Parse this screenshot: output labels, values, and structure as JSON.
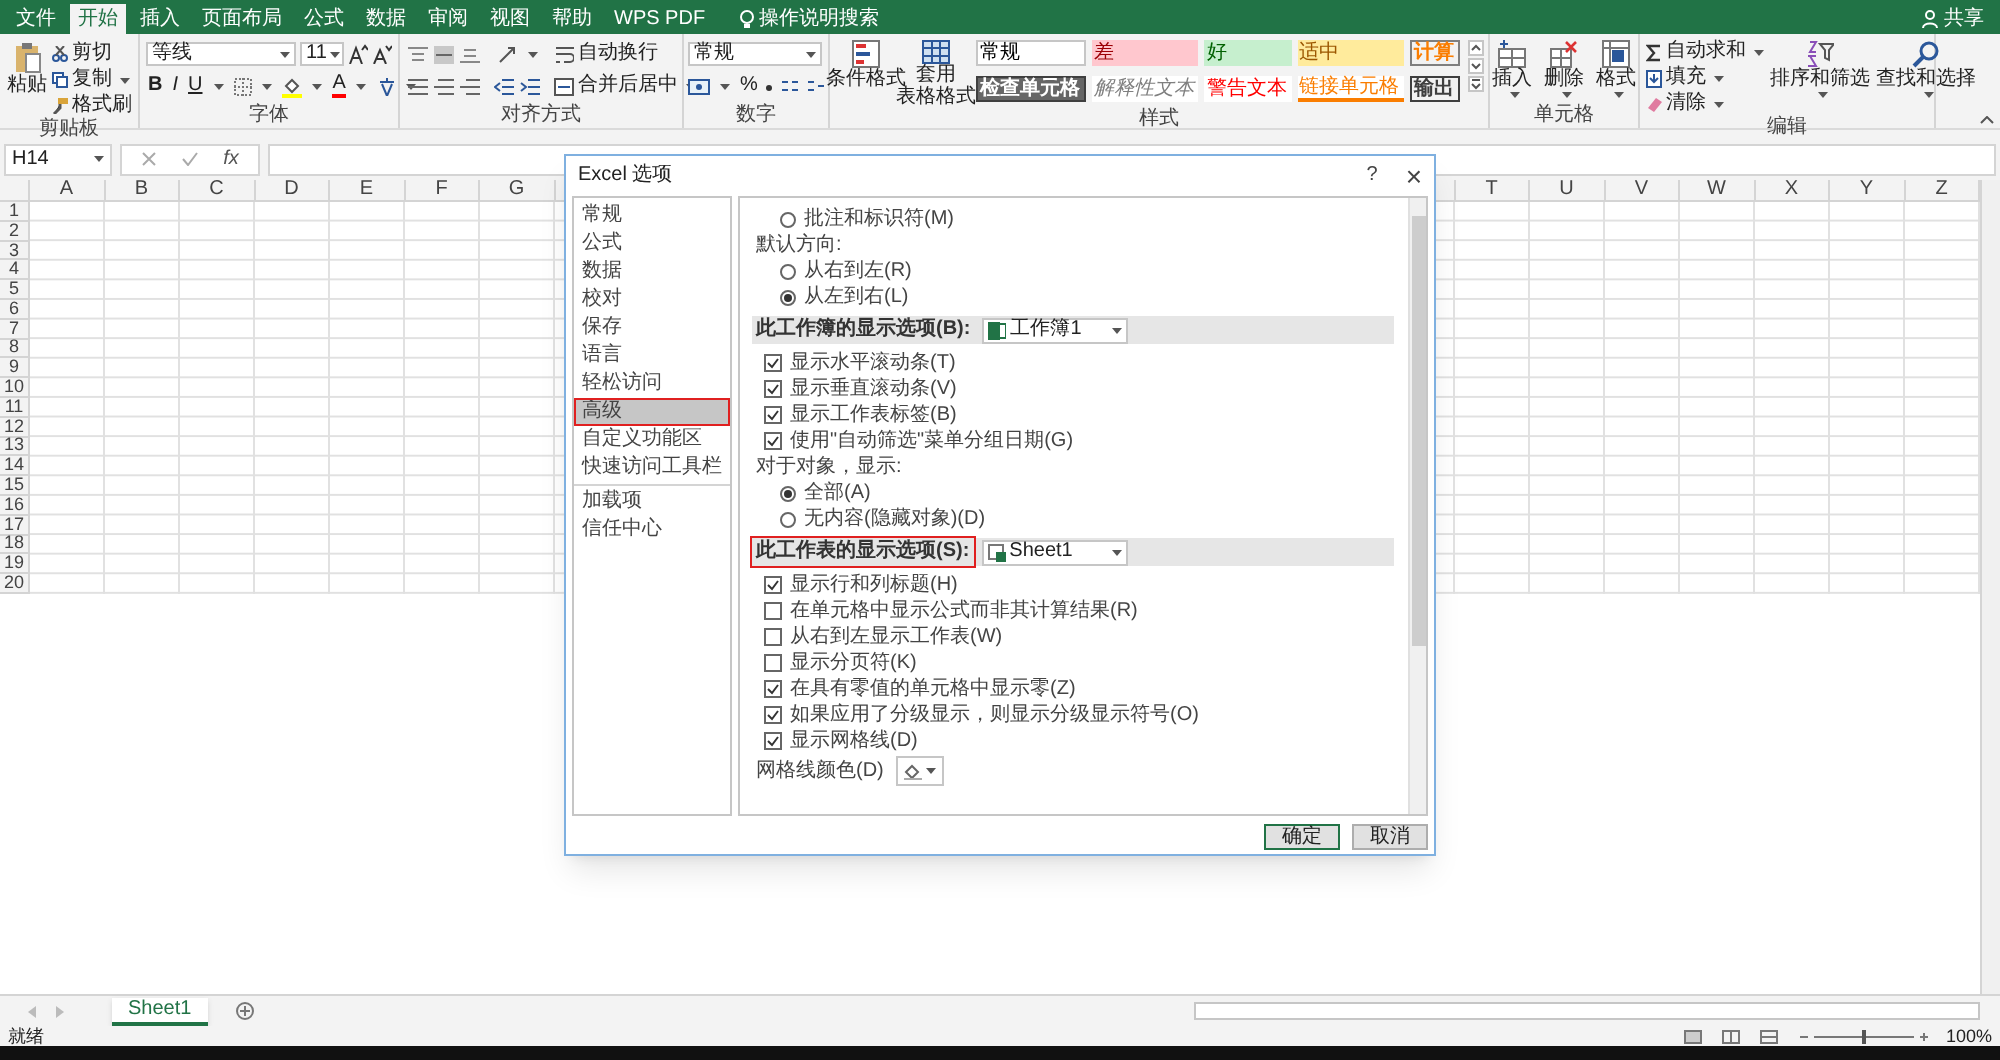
{
  "menu_tabs": [
    {
      "label": "文件",
      "selected": false
    },
    {
      "label": "开始",
      "selected": true
    },
    {
      "label": "插入",
      "selected": false
    },
    {
      "label": "页面布局",
      "selected": false
    },
    {
      "label": "公式",
      "selected": false
    },
    {
      "label": "数据",
      "selected": false
    },
    {
      "label": "审阅",
      "selected": false
    },
    {
      "label": "视图",
      "selected": false
    },
    {
      "label": "帮助",
      "selected": false
    },
    {
      "label": "WPS PDF",
      "selected": false
    }
  ],
  "tell_me": "操作说明搜索",
  "share": "共享",
  "ribbon": {
    "clipboard": {
      "label": "剪贴板",
      "paste": "粘贴",
      "cut": "剪切",
      "copy": "复制",
      "format_painter": "格式刷"
    },
    "font": {
      "label": "字体",
      "font_name": "等线",
      "font_size": "11",
      "bold": "B",
      "italic": "I",
      "underline": "U",
      "font_color": "A"
    },
    "alignment": {
      "label": "对齐方式",
      "wrap_text": "自动换行",
      "merge_center": "合并后居中"
    },
    "number": {
      "label": "数字",
      "format": "常规",
      "percent": "%"
    },
    "styles": {
      "label": "样式",
      "conditional": "条件格式",
      "table_format": [
        "套用",
        "表格格式"
      ],
      "cell_styles": [
        {
          "text": "常规",
          "kind": "normal"
        },
        {
          "text": "差",
          "kind": "bad"
        },
        {
          "text": "好",
          "kind": "good"
        },
        {
          "text": "适中",
          "kind": "neutral"
        },
        {
          "text": "计算",
          "kind": "calculation"
        },
        {
          "text": "检查单元格",
          "kind": "check"
        },
        {
          "text": "解释性文本",
          "kind": "explanatory"
        },
        {
          "text": "警告文本",
          "kind": "warning"
        },
        {
          "text": "链接单元格",
          "kind": "linked"
        },
        {
          "text": "输出",
          "kind": "output"
        }
      ]
    },
    "cells": {
      "label": "单元格",
      "insert": "插入",
      "delete": "删除",
      "format": "格式"
    },
    "editing": {
      "label": "编辑",
      "autosum": "自动求和",
      "fill": "填充",
      "clear": "清除",
      "sort_filter": "排序和筛选",
      "find_select": "查找和选择"
    }
  },
  "name_box": "H14",
  "fx": "fx",
  "columns_left": [
    "A",
    "B",
    "C",
    "D",
    "E",
    "F",
    "G"
  ],
  "columns_right": [
    "T",
    "U",
    "V",
    "W",
    "X",
    "Y",
    "Z"
  ],
  "rows": [
    "1",
    "2",
    "3",
    "4",
    "5",
    "6",
    "7",
    "8",
    "9",
    "10",
    "11",
    "12",
    "13",
    "14",
    "15",
    "16",
    "17",
    "18",
    "19",
    "20"
  ],
  "sheet_tabs": [
    {
      "label": "Sheet1",
      "selected": true
    }
  ],
  "status": "就绪",
  "zoom": "100%",
  "zoom_slider": {
    "level": 0.5
  },
  "dialog": {
    "title": "Excel 选项",
    "help": "?",
    "close": "×",
    "nav": [
      {
        "label": "常规",
        "selected": false,
        "highlighted": false
      },
      {
        "label": "公式",
        "selected": false,
        "highlighted": false
      },
      {
        "label": "数据",
        "selected": false,
        "highlighted": false
      },
      {
        "label": "校对",
        "selected": false,
        "highlighted": false
      },
      {
        "label": "保存",
        "selected": false,
        "highlighted": false
      },
      {
        "label": "语言",
        "selected": false,
        "highlighted": false
      },
      {
        "label": "轻松访问",
        "selected": false,
        "highlighted": false
      },
      {
        "label": "高级",
        "selected": true,
        "highlighted": true
      },
      {
        "label": "自定义功能区",
        "selected": false,
        "highlighted": false
      },
      {
        "label": "快速访问工具栏",
        "selected": false,
        "highlighted": false
      },
      {
        "label": "加载项",
        "selected": false,
        "highlighted": false
      },
      {
        "label": "信任中心",
        "selected": false,
        "highlighted": false
      }
    ],
    "options": [
      {
        "kind": "radio",
        "label": "批注和标识符(M)",
        "selected": false
      },
      {
        "kind": "label",
        "label": "默认方向:"
      },
      {
        "kind": "radio",
        "label": "从右到左(R)",
        "selected": false
      },
      {
        "kind": "radio",
        "label": "从左到右(L)",
        "selected": true
      },
      {
        "kind": "section",
        "label": "此工作簿的显示选项(B):",
        "value": "工作簿1",
        "highlighted": false
      },
      {
        "kind": "checkbox",
        "label": "显示水平滚动条(T)",
        "checked": true
      },
      {
        "kind": "checkbox",
        "label": "显示垂直滚动条(V)",
        "checked": true
      },
      {
        "kind": "checkbox",
        "label": "显示工作表标签(B)",
        "checked": true
      },
      {
        "kind": "checkbox",
        "label": "使用\"自动筛选\"菜单分组日期(G)",
        "checked": true
      },
      {
        "kind": "label",
        "label": "对于对象，显示:"
      },
      {
        "kind": "radio",
        "label": "全部(A)",
        "selected": true
      },
      {
        "kind": "radio",
        "label": "无内容(隐藏对象)(D)",
        "selected": false
      },
      {
        "kind": "section",
        "label": "此工作表的显示选项(S):",
        "value": "Sheet1",
        "highlighted": true
      },
      {
        "kind": "checkbox",
        "label": "显示行和列标题(H)",
        "checked": true
      },
      {
        "kind": "checkbox",
        "label": "在单元格中显示公式而非其计算结果(R)",
        "checked": false
      },
      {
        "kind": "checkbox",
        "label": "从右到左显示工作表(W)",
        "checked": false
      },
      {
        "kind": "checkbox",
        "label": "显示分页符(K)",
        "checked": false
      },
      {
        "kind": "checkbox",
        "label": "在具有零值的单元格中显示零(Z)",
        "checked": true
      },
      {
        "kind": "checkbox",
        "label": "如果应用了分级显示，则显示分级显示符号(O)",
        "checked": true
      },
      {
        "kind": "checkbox",
        "label": "显示网格线(D)",
        "checked": true
      },
      {
        "kind": "color",
        "label": "网格线颜色(D)"
      }
    ],
    "ok": "确定",
    "cancel": "取消"
  }
}
